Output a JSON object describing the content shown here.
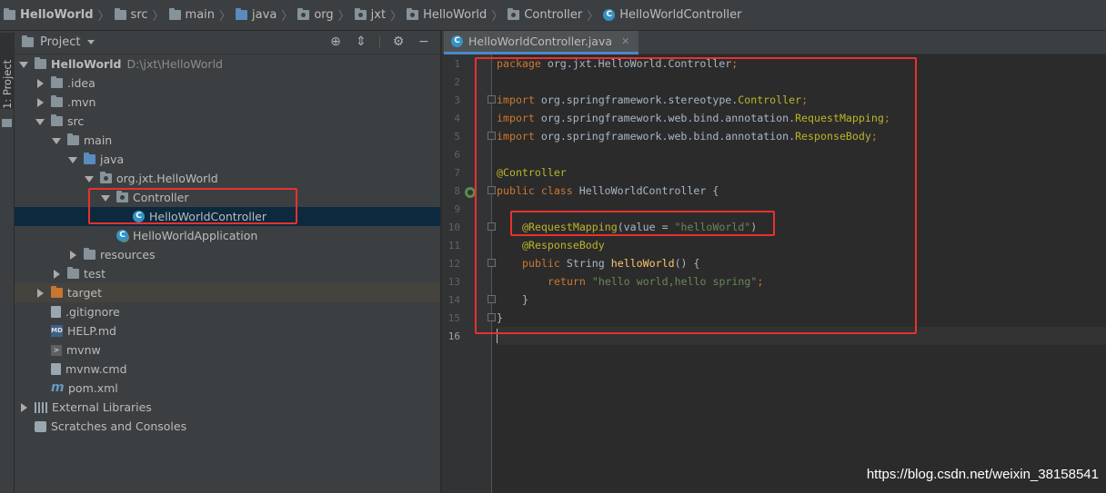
{
  "breadcrumbs": [
    {
      "label": "HelloWorld",
      "icon": "project-icon"
    },
    {
      "label": "src",
      "icon": "folder-icon"
    },
    {
      "label": "main",
      "icon": "folder-icon"
    },
    {
      "label": "java",
      "icon": "folder-icon"
    },
    {
      "label": "org",
      "icon": "folder-icon"
    },
    {
      "label": "jxt",
      "icon": "folder-icon"
    },
    {
      "label": "HelloWorld",
      "icon": "folder-icon"
    },
    {
      "label": "Controller",
      "icon": "folder-icon"
    },
    {
      "label": "HelloWorldController",
      "icon": "class-icon"
    }
  ],
  "toolstrip": {
    "project_tab": "1: Project"
  },
  "project_panel": {
    "title": "Project",
    "tree": [
      {
        "name": "HelloWorld",
        "path": "D:\\jxt\\HelloWorld",
        "icon": "project-folder-icon",
        "twisty": "open"
      },
      {
        "name": ".idea",
        "icon": "folder-icon",
        "twisty": "closed"
      },
      {
        "name": ".mvn",
        "icon": "folder-icon",
        "twisty": "closed"
      },
      {
        "name": "src",
        "icon": "folder-icon",
        "twisty": "open"
      },
      {
        "name": "main",
        "icon": "folder-icon",
        "twisty": "open"
      },
      {
        "name": "java",
        "icon": "source-folder-icon",
        "twisty": "open"
      },
      {
        "name": "org.jxt.HelloWorld",
        "icon": "package-icon",
        "twisty": "open"
      },
      {
        "name": "Controller",
        "icon": "package-icon",
        "twisty": "open"
      },
      {
        "name": "HelloWorldController",
        "icon": "class-icon",
        "twisty": "none"
      },
      {
        "name": "HelloWorldApplication",
        "icon": "spring-app-icon",
        "twisty": "none"
      },
      {
        "name": "resources",
        "icon": "resources-folder-icon",
        "twisty": "closed"
      },
      {
        "name": "test",
        "icon": "folder-icon",
        "twisty": "closed"
      },
      {
        "name": "target",
        "icon": "excluded-folder-icon",
        "twisty": "closed"
      },
      {
        "name": ".gitignore",
        "icon": "file-icon",
        "twisty": "none"
      },
      {
        "name": "HELP.md",
        "icon": "markdown-icon",
        "twisty": "none"
      },
      {
        "name": "mvnw",
        "icon": "terminal-icon",
        "twisty": "none"
      },
      {
        "name": "mvnw.cmd",
        "icon": "file-icon",
        "twisty": "none"
      },
      {
        "name": "pom.xml",
        "icon": "maven-icon",
        "twisty": "none"
      },
      {
        "name": "External Libraries",
        "icon": "libraries-icon",
        "twisty": "closed"
      },
      {
        "name": "Scratches and Consoles",
        "icon": "scratches-icon",
        "twisty": "none"
      }
    ]
  },
  "editor": {
    "tab_label": "HelloWorldController.java",
    "line_numbers": [
      "1",
      "2",
      "3",
      "4",
      "5",
      "6",
      "7",
      "8",
      "9",
      "10",
      "11",
      "12",
      "13",
      "14",
      "15",
      "16"
    ],
    "code": {
      "l1a": "package ",
      "l1b": "org.jxt.HelloWorld.Controller",
      "l1c": ";",
      "l3a": "import ",
      "l3b": "org.springframework.stereotype.",
      "l3c": "Controller",
      "l3d": ";",
      "l4a": "import ",
      "l4b": "org.springframework.web.bind.annotation.",
      "l4c": "RequestMapping",
      "l4d": ";",
      "l5a": "import ",
      "l5b": "org.springframework.web.bind.annotation.",
      "l5c": "ResponseBody",
      "l5d": ";",
      "l7a": "@Controller",
      "l8a": "public class ",
      "l8b": "HelloWorldController {",
      "l10a": "@RequestMapping",
      "l10b": "(value = ",
      "l10c": "\"helloWorld\"",
      "l10d": ")",
      "l11a": "@ResponseBody",
      "l12a": "public ",
      "l12b": "String ",
      "l12c": "helloWorld",
      "l12d": "() {",
      "l13a": "return ",
      "l13b": "\"hello world,hello spring\"",
      "l13c": ";",
      "l14a": "}",
      "l15a": "}"
    }
  },
  "watermark": "https://blog.csdn.net/weixin_38158541",
  "colors": {
    "highlight_box": "#e8312f",
    "selection": "#0d293e",
    "keyword": "#cc7832",
    "annotation": "#bbb529",
    "string": "#6a8759"
  }
}
